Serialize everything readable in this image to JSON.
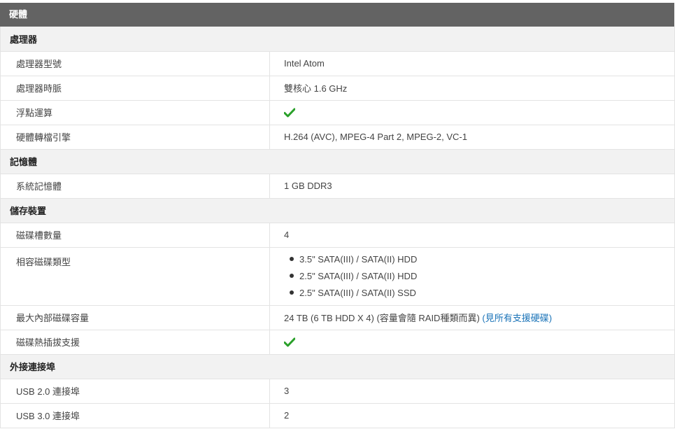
{
  "header": {
    "title": "硬體"
  },
  "colors": {
    "header_bg": "#636363",
    "section_bg": "#f2f2f2",
    "check": "#2aa02a",
    "link": "#1a73b8"
  },
  "sections": {
    "cpu": {
      "title": "處理器",
      "rows": {
        "model": {
          "label": "處理器型號",
          "value": "Intel Atom"
        },
        "freq": {
          "label": "處理器時脈",
          "value": "雙核心 1.6 GHz"
        },
        "fpu": {
          "label": "浮點運算",
          "value_icon": "check-icon"
        },
        "transcode": {
          "label": "硬體轉檔引擎",
          "value": "H.264 (AVC), MPEG-4 Part 2, MPEG-2, VC-1"
        }
      }
    },
    "memory": {
      "title": "記憶體",
      "rows": {
        "ram": {
          "label": "系統記憶體",
          "value": "1 GB DDR3"
        }
      }
    },
    "storage": {
      "title": "儲存裝置",
      "rows": {
        "bays": {
          "label": "磁碟槽數量",
          "value": "4"
        },
        "types": {
          "label": "相容磁碟類型",
          "items": [
            "3.5\" SATA(III) / SATA(II) HDD",
            "2.5\" SATA(III) / SATA(II) HDD",
            "2.5\" SATA(III) / SATA(II) SSD"
          ]
        },
        "capacity": {
          "label": "最大內部磁碟容量",
          "value": "24 TB (6 TB HDD X 4) (容量會隨 RAID種類而異)",
          "link": "(見所有支援硬碟)"
        },
        "hotswap": {
          "label": "磁碟熱插拔支援",
          "value_icon": "check-icon"
        }
      }
    },
    "ports": {
      "title": "外接連接埠",
      "rows": {
        "usb2": {
          "label": "USB 2.0 連接埠",
          "value": "3"
        },
        "usb3": {
          "label": "USB 3.0 連接埠",
          "value": "2"
        }
      }
    }
  }
}
